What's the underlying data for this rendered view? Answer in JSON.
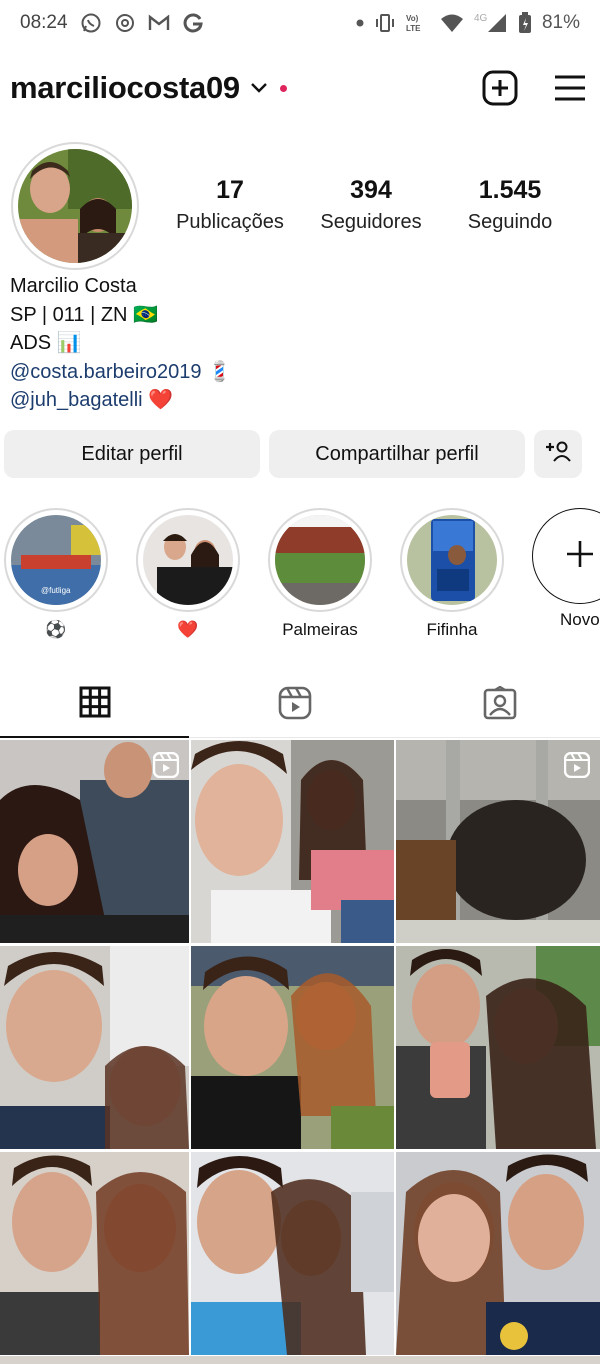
{
  "status_bar": {
    "time": "08:24",
    "battery": "81%",
    "network": "4G",
    "volte": "Vo) LTE",
    "left_icons": [
      "whatsapp-icon",
      "sync-icon",
      "gmail-icon",
      "google-icon"
    ],
    "right_icons": [
      "dot-icon",
      "vibrate-icon",
      "volte-icon",
      "wifi-icon",
      "signal-icon",
      "battery-icon"
    ]
  },
  "header": {
    "username": "marciliocosta09",
    "actions": [
      "new-post-icon",
      "menu-icon"
    ]
  },
  "profile": {
    "stats": [
      {
        "value": "17",
        "label": "Publicações"
      },
      {
        "value": "394",
        "label": "Seguidores"
      },
      {
        "value": "1.545",
        "label": "Seguindo"
      }
    ],
    "bio": {
      "name": "Marcilio Costa",
      "line1": "SP | 011 | ZN 🇧🇷",
      "line2": "ADS 📊",
      "mention1": "@costa.barbeiro2019 💈",
      "mention2": "@juh_bagatelli ❤️"
    }
  },
  "buttons": {
    "edit": "Editar perfil",
    "share": "Compartilhar perfil"
  },
  "highlights": [
    {
      "label": "⚽",
      "overlay": "@futliga"
    },
    {
      "label": "❤️"
    },
    {
      "label": "Palmeiras"
    },
    {
      "label": "Fifinha"
    },
    {
      "label": "Novo"
    }
  ],
  "tabs": [
    "grid-icon",
    "reels-icon",
    "tagged-icon"
  ],
  "colors": {
    "accent_dot": "#e0245e",
    "link": "#1c3d6e",
    "button_bg": "#efefef"
  }
}
